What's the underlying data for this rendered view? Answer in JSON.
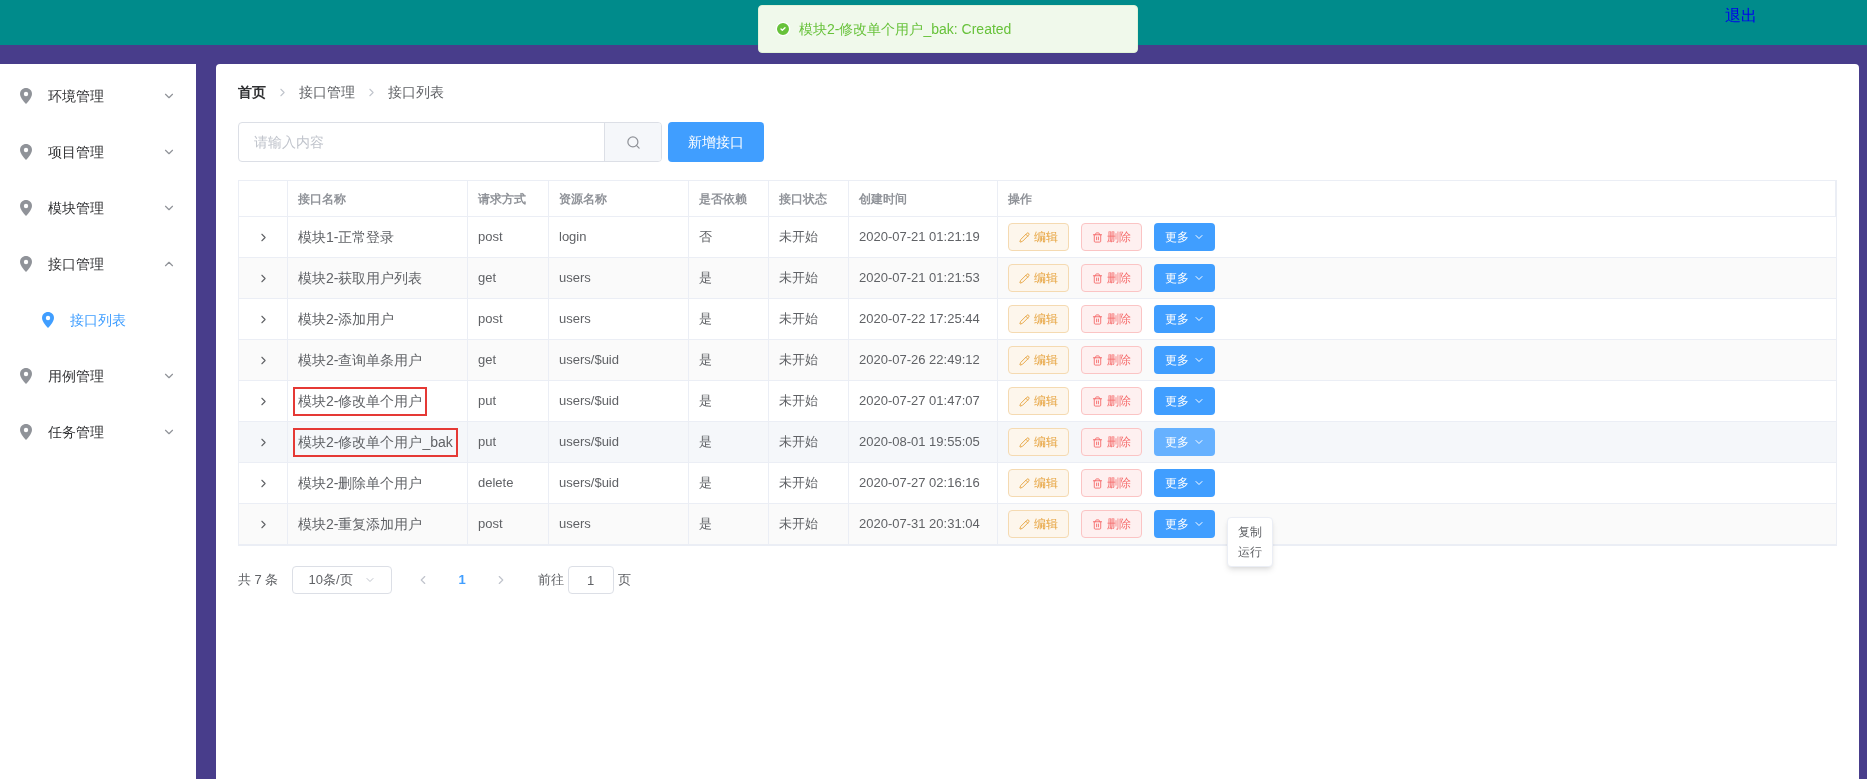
{
  "header": {
    "logout": "退出"
  },
  "toast": {
    "message": "模块2-修改单个用户_bak: Created"
  },
  "sidebar": {
    "items": [
      {
        "label": "环境管理",
        "expanded": false
      },
      {
        "label": "项目管理",
        "expanded": false
      },
      {
        "label": "模块管理",
        "expanded": false
      },
      {
        "label": "接口管理",
        "expanded": true,
        "children": [
          {
            "label": "接口列表",
            "selected": true
          }
        ]
      },
      {
        "label": "用例管理",
        "expanded": false
      },
      {
        "label": "任务管理",
        "expanded": false
      }
    ]
  },
  "breadcrumb": [
    "首页",
    "接口管理",
    "接口列表"
  ],
  "search": {
    "placeholder": "请输入内容"
  },
  "add_button": "新增接口",
  "table": {
    "columns": [
      "接口名称",
      "请求方式",
      "资源名称",
      "是否依赖",
      "接口状态",
      "创建时间",
      "操作"
    ],
    "rows": [
      {
        "cells": [
          "模块1-正常登录",
          "post",
          "login",
          "否",
          "未开始",
          "2020-07-21 01:21:19"
        ],
        "outlined": false,
        "hovered": false,
        "actions": [
          "编辑",
          "删除",
          "更多"
        ]
      },
      {
        "cells": [
          "模块2-获取用户列表",
          "get",
          "users",
          "是",
          "未开始",
          "2020-07-21 01:21:53"
        ],
        "outlined": false,
        "hovered": false,
        "actions": [
          "编辑",
          "删除",
          "更多"
        ]
      },
      {
        "cells": [
          "模块2-添加用户",
          "post",
          "users",
          "是",
          "未开始",
          "2020-07-22 17:25:44"
        ],
        "outlined": false,
        "hovered": false,
        "actions": [
          "编辑",
          "删除",
          "更多"
        ]
      },
      {
        "cells": [
          "模块2-查询单条用户",
          "get",
          "users/$uid",
          "是",
          "未开始",
          "2020-07-26 22:49:12"
        ],
        "outlined": false,
        "hovered": false,
        "actions": [
          "编辑",
          "删除",
          "更多"
        ]
      },
      {
        "cells": [
          "模块2-修改单个用户",
          "put",
          "users/$uid",
          "是",
          "未开始",
          "2020-07-27 01:47:07"
        ],
        "outlined": true,
        "hovered": false,
        "actions": [
          "编辑",
          "删除",
          "更多"
        ]
      },
      {
        "cells": [
          "模块2-修改单个用户_bak",
          "put",
          "users/$uid",
          "是",
          "未开始",
          "2020-08-01 19:55:05"
        ],
        "outlined": true,
        "hovered": true,
        "actions": [
          "编辑",
          "删除",
          "更多"
        ]
      },
      {
        "cells": [
          "模块2-删除单个用户",
          "delete",
          "users/$uid",
          "是",
          "未开始",
          "2020-07-27 02:16:16"
        ],
        "outlined": false,
        "hovered": false,
        "actions": [
          "编辑",
          "删除",
          "更多"
        ]
      },
      {
        "cells": [
          "模块2-重复添加用户",
          "post",
          "users",
          "是",
          "未开始",
          "2020-07-31 20:31:04"
        ],
        "outlined": false,
        "hovered": false,
        "actions": [
          "编辑",
          "删除",
          "更多"
        ]
      }
    ]
  },
  "more_menu": {
    "items": [
      "复制",
      "运行"
    ]
  },
  "pagination": {
    "total": "共 7 条",
    "page_size": "10条/页",
    "current": "1",
    "goto_label": "前往",
    "goto_value": "1",
    "page_suffix": "页"
  }
}
